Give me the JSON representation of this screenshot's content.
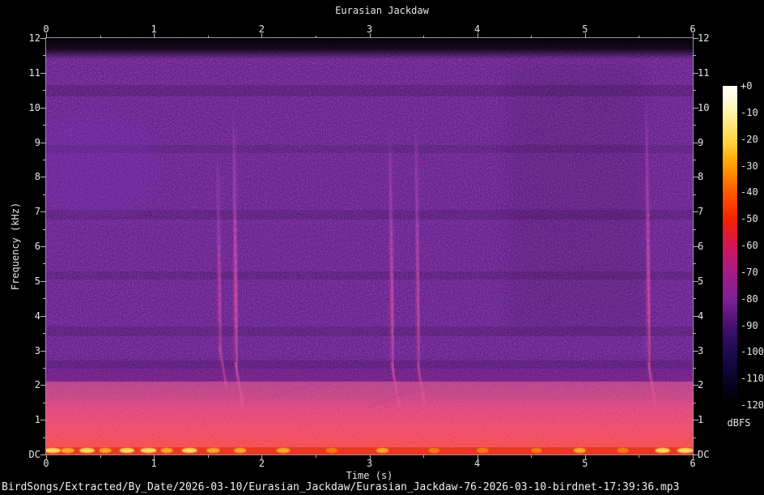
{
  "chart_data": {
    "type": "spectrogram",
    "title": "Eurasian Jackdaw",
    "xlabel": "Time (s)",
    "ylabel": "Frequency (kHz)",
    "colorbar_label": "dBFS",
    "x_range_s": [
      0,
      6
    ],
    "y_range_khz": [
      0,
      12
    ],
    "x_major_ticks": [
      "0",
      "1",
      "2",
      "3",
      "4",
      "5",
      "6"
    ],
    "x_minor_step_s": 0.5,
    "y_major_ticks": [
      "12",
      "11",
      "10",
      "9",
      "8",
      "7",
      "6",
      "5",
      "4",
      "3",
      "2",
      "1",
      "DC"
    ],
    "y_minor_step_khz": 0.5,
    "colorbar_ticks": [
      "+0",
      "-10",
      "-20",
      "-30",
      "-40",
      "-50",
      "-60",
      "-70",
      "-80",
      "-90",
      "-100",
      "-110",
      "-120"
    ],
    "colorbar_range_dbfs": [
      0,
      -120
    ],
    "colorbar_palette": [
      {
        "pos": 0,
        "color": "#ffffff"
      },
      {
        "pos": 3,
        "color": "#fffce8"
      },
      {
        "pos": 8,
        "color": "#fff3ae"
      },
      {
        "pos": 17,
        "color": "#ffd741"
      },
      {
        "pos": 25,
        "color": "#ff9e00"
      },
      {
        "pos": 33,
        "color": "#ff5c00"
      },
      {
        "pos": 42,
        "color": "#f32000"
      },
      {
        "pos": 50,
        "color": "#d31458"
      },
      {
        "pos": 58,
        "color": "#a81b85"
      },
      {
        "pos": 67,
        "color": "#7c2097"
      },
      {
        "pos": 75,
        "color": "#471071"
      },
      {
        "pos": 83,
        "color": "#1d0a55"
      },
      {
        "pos": 92,
        "color": "#090428"
      },
      {
        "pos": 100,
        "color": "#000000"
      }
    ],
    "background_noise_dbfs": -100,
    "low_band": {
      "freq_khz": [
        0,
        1.8
      ],
      "peak_level_dbfs": -55
    },
    "dc_edge_level_dbfs": -25,
    "noise_patch": {
      "t_range_s": [
        0.0,
        0.9
      ],
      "f_range_khz": [
        6.8,
        9.8
      ]
    },
    "edge_artifact": {
      "t_s": 0.02,
      "f_range_khz": [
        0.2,
        11.5
      ]
    },
    "calls": [
      {
        "t_s": 1.6,
        "f_lo_khz": 2.5,
        "f_hi_khz": 9.0,
        "intensity": 0.35
      },
      {
        "t_s": 1.75,
        "f_lo_khz": 2.0,
        "f_hi_khz": 10.2,
        "intensity": 0.8
      },
      {
        "t_s": 3.2,
        "f_lo_khz": 2.0,
        "f_hi_khz": 9.6,
        "intensity": 0.65
      },
      {
        "t_s": 3.44,
        "f_lo_khz": 2.0,
        "f_hi_khz": 10.0,
        "intensity": 0.5
      },
      {
        "t_s": 5.58,
        "f_lo_khz": 2.0,
        "f_hi_khz": 10.5,
        "intensity": 0.7
      }
    ],
    "faint_traces": [
      {
        "t_range_s": [
          2.08,
          2.56
        ],
        "f_range_khz": [
          1.65,
          2.1
        ]
      },
      {
        "t_range_s": [
          2.98,
          3.42
        ],
        "f_range_khz": [
          1.35,
          1.9
        ]
      }
    ],
    "dc_hotspots": [
      {
        "t_s": 0.06,
        "strength": 1.0
      },
      {
        "t_s": 0.2,
        "strength": 0.7
      },
      {
        "t_s": 0.38,
        "strength": 0.9
      },
      {
        "t_s": 0.55,
        "strength": 0.6
      },
      {
        "t_s": 0.75,
        "strength": 0.85
      },
      {
        "t_s": 0.95,
        "strength": 1.0
      },
      {
        "t_s": 1.12,
        "strength": 0.6
      },
      {
        "t_s": 1.33,
        "strength": 0.9
      },
      {
        "t_s": 1.55,
        "strength": 0.7
      },
      {
        "t_s": 1.8,
        "strength": 0.6
      },
      {
        "t_s": 2.2,
        "strength": 0.75
      },
      {
        "t_s": 2.65,
        "strength": 0.5
      },
      {
        "t_s": 3.12,
        "strength": 0.6
      },
      {
        "t_s": 3.6,
        "strength": 0.45
      },
      {
        "t_s": 4.05,
        "strength": 0.55
      },
      {
        "t_s": 4.55,
        "strength": 0.45
      },
      {
        "t_s": 4.95,
        "strength": 0.6
      },
      {
        "t_s": 5.35,
        "strength": 0.5
      },
      {
        "t_s": 5.72,
        "strength": 0.85
      },
      {
        "t_s": 5.93,
        "strength": 1.0
      }
    ]
  },
  "footer": {
    "file_path": "BirdSongs/Extracted/By_Date/2026-03-10/Eurasian_Jackdaw/Eurasian_Jackdaw-76-2026-03-10-birdnet-17:39:36.mp3"
  }
}
